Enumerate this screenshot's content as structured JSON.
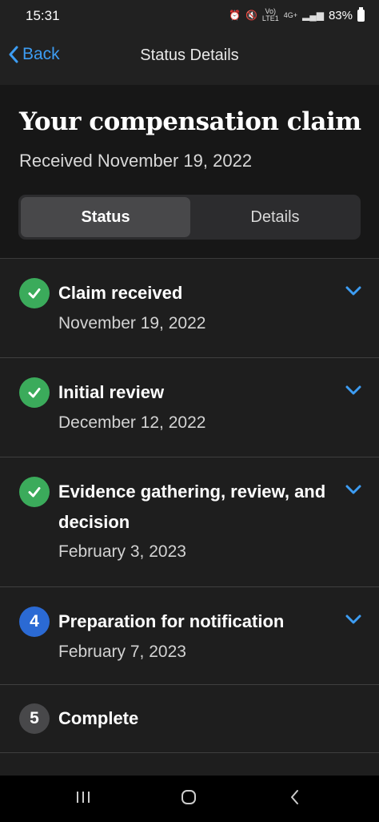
{
  "status_bar": {
    "time": "15:31",
    "network_top": "Vo)",
    "network_bottom": "LTE1",
    "signal_type": "4G+",
    "battery": "83%"
  },
  "nav": {
    "back_label": "Back",
    "title": "Status Details"
  },
  "header": {
    "title": "Your compensation claim",
    "received": "Received November 19, 2022",
    "tabs": {
      "status": "Status",
      "details": "Details"
    }
  },
  "steps": [
    {
      "badge": "",
      "state": "done",
      "title": "Claim received",
      "date": "November 19, 2022",
      "icon": "check-icon"
    },
    {
      "badge": "",
      "state": "done",
      "title": "Initial review",
      "date": "December 12, 2022",
      "icon": "check-icon"
    },
    {
      "badge": "",
      "state": "done",
      "title": "Evidence gathering, review, and decision",
      "date": "February 3, 2023",
      "icon": "check-icon"
    },
    {
      "badge": "4",
      "state": "current",
      "title": "Preparation for notification",
      "date": "February 7, 2023"
    },
    {
      "badge": "5",
      "state": "pending",
      "title": "Complete",
      "date": ""
    }
  ],
  "colors": {
    "accent": "#3d9df3",
    "done": "#3bab5b",
    "current": "#2b6ad4",
    "pending": "#48484a"
  }
}
